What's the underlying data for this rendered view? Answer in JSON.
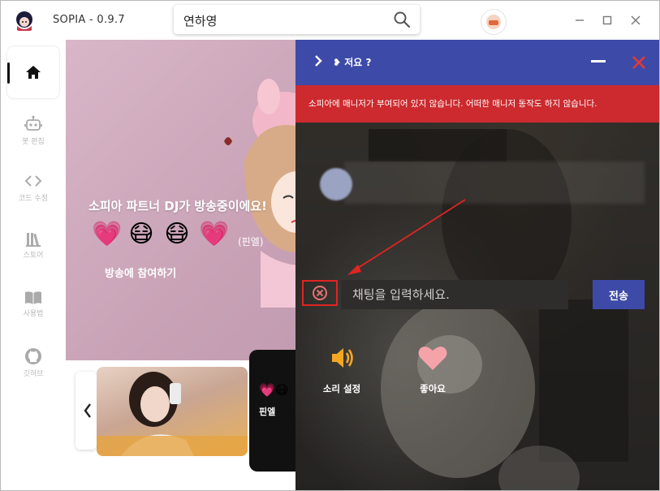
{
  "app": {
    "title": "SOPIA - 0.9.7"
  },
  "search": {
    "value": "연하영"
  },
  "window_controls": {
    "minimize": "minimize",
    "maximize": "maximize",
    "close": "close"
  },
  "sidebar": {
    "items": [
      {
        "label": "",
        "icon": "home-icon",
        "active": true
      },
      {
        "label": "봇 편집",
        "icon": "robot-icon"
      },
      {
        "label": "코드 수정",
        "icon": "code-icon"
      },
      {
        "label": "스토어",
        "icon": "library-icon"
      },
      {
        "label": "사용법",
        "icon": "book-icon"
      },
      {
        "label": "깃허브",
        "icon": "github-icon"
      }
    ]
  },
  "banner": {
    "headline": "소피아 파트너 DJ가 방송중이에요!",
    "emojis": [
      "💗",
      "😷",
      "😷",
      "💗"
    ],
    "caption": "(핀엘)",
    "join_label": "방송에 참여하기"
  },
  "cards": {
    "dark_label": "핀엘",
    "dark_emojis": "💗😷"
  },
  "overlay": {
    "title": "❥ 저요 ?",
    "warning": "소피아에 매니저가 부여되어 있지 않습니다. 어떠한 매니저 동작도 하지 않습니다.",
    "chat": {
      "placeholder": "채팅을 입력하세요.",
      "send_label": "전송"
    },
    "actions": [
      {
        "label": "소리 설정",
        "icon": "speaker-icon"
      },
      {
        "label": "좋아요",
        "icon": "heart-icon"
      }
    ]
  },
  "colors": {
    "accent": "#3e4aa7",
    "warning": "#cc2a2e",
    "highlight": "#e02424"
  }
}
